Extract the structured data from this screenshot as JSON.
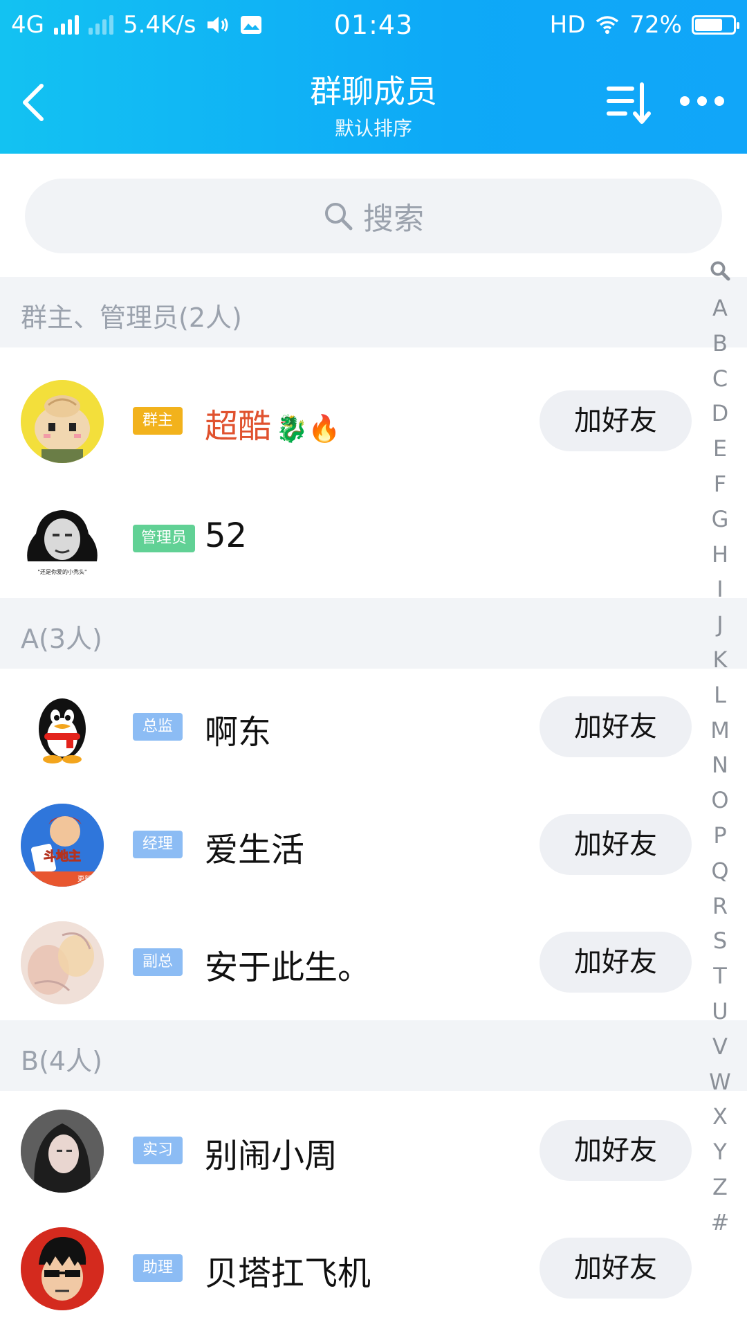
{
  "status_bar": {
    "network": "4G",
    "speed": "5.4K/s",
    "time": "01:43",
    "hd": "HD",
    "battery": "72%",
    "battery_level": 0.72
  },
  "nav": {
    "title": "群聊成员",
    "subtitle": "默认排序",
    "back_icon": "chevron-left-icon",
    "sort_icon": "sort-icon",
    "more_icon": "more-dots-icon"
  },
  "search": {
    "placeholder": "搜索"
  },
  "sections": [
    {
      "title": "群主、管理员(2人)"
    },
    {
      "title": "A(3人)"
    },
    {
      "title": "B(4人)"
    }
  ],
  "members": [
    {
      "badge": "群主",
      "name": "超酷",
      "emoji": "🐉🔥",
      "add_label": "加好友",
      "badge_color": "#f2b21c",
      "name_color": "#e0522f"
    },
    {
      "badge": "管理员",
      "name": "52",
      "emoji": "",
      "add_label": "",
      "badge_color": "#61d195",
      "name_color": "#111111"
    },
    {
      "badge": "总监",
      "name": "啊东",
      "emoji": "",
      "add_label": "加好友",
      "badge_color": "#8cbcf4",
      "name_color": "#111111"
    },
    {
      "badge": "经理",
      "name": "爱生活",
      "emoji": "",
      "add_label": "加好友",
      "badge_color": "#8cbcf4",
      "name_color": "#111111"
    },
    {
      "badge": "副总",
      "name": "安于此生。",
      "emoji": "",
      "add_label": "加好友",
      "badge_color": "#8cbcf4",
      "name_color": "#111111"
    },
    {
      "badge": "实习",
      "name": "别闹小周",
      "emoji": "",
      "add_label": "加好友",
      "badge_color": "#8cbcf4",
      "name_color": "#111111"
    },
    {
      "badge": "助理",
      "name": "贝塔扛飞机",
      "emoji": "",
      "add_label": "加好友",
      "badge_color": "#8cbcf4",
      "name_color": "#111111"
    }
  ],
  "avatar_captions": {
    "admin_meme": "\"还是你爱的小秃头\"",
    "game_logo": "斗地主",
    "game_tag": "更新"
  },
  "index_letters": [
    "A",
    "B",
    "C",
    "D",
    "E",
    "F",
    "G",
    "H",
    "I",
    "J",
    "K",
    "L",
    "M",
    "N",
    "O",
    "P",
    "Q",
    "R",
    "S",
    "T",
    "U",
    "V",
    "W",
    "X",
    "Y",
    "Z",
    "#"
  ]
}
